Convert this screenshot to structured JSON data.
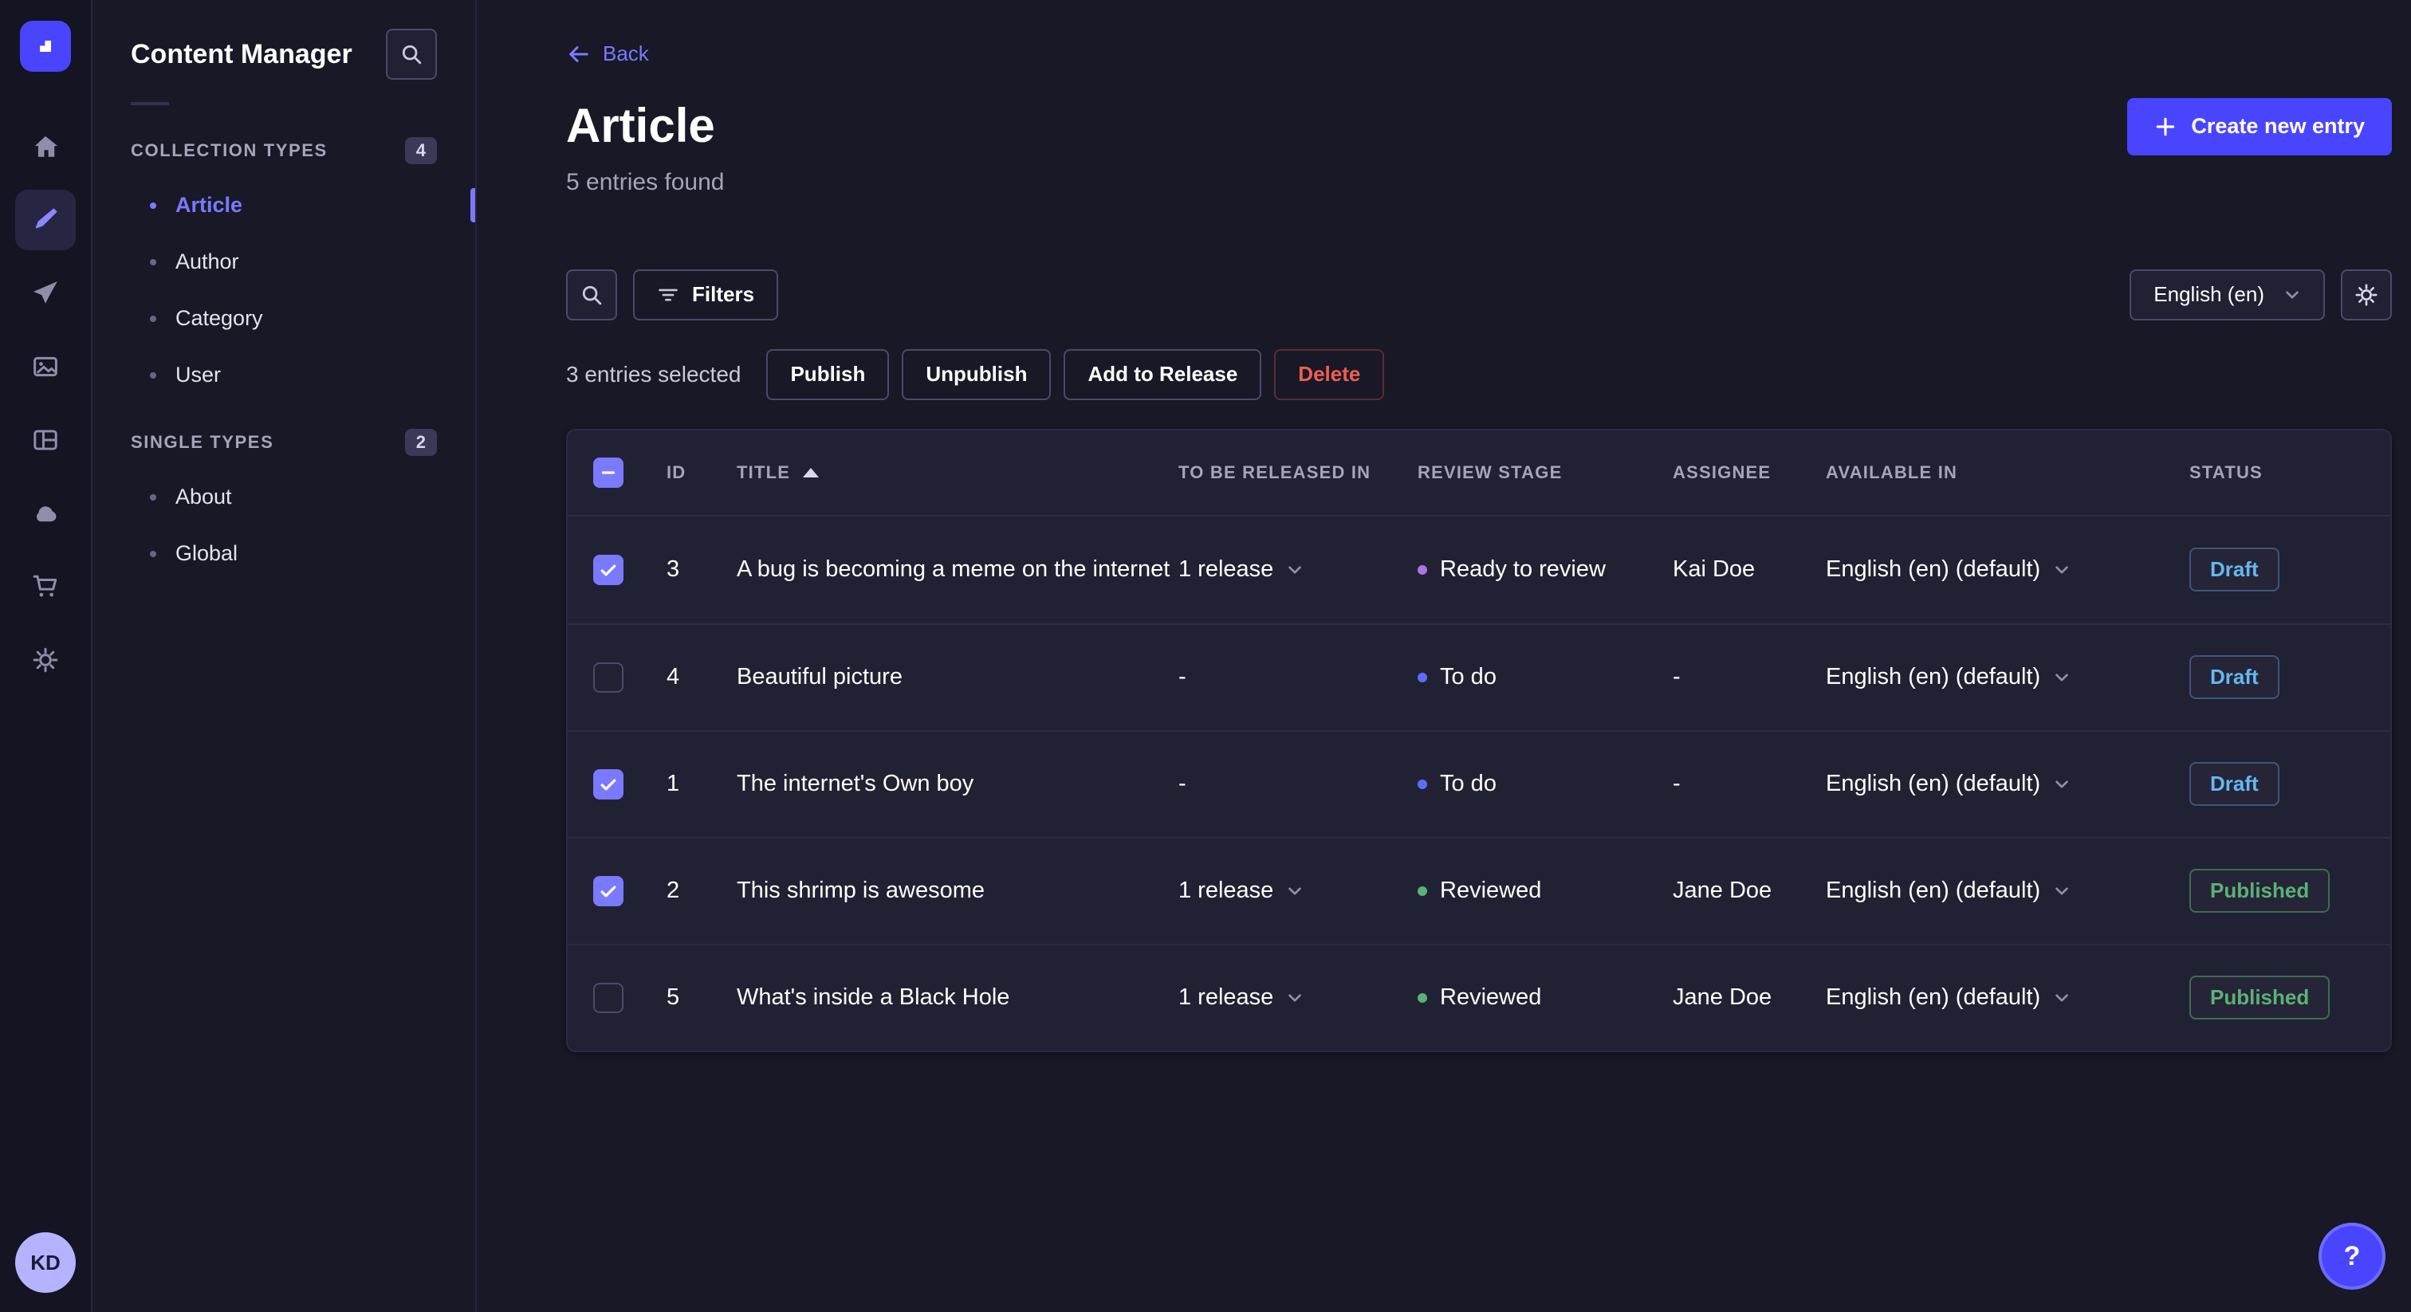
{
  "colors": {
    "accent": "#4945ff",
    "accent_light": "#7b79ff",
    "danger": "#ee5e52",
    "success": "#5cb176",
    "draft": "#66b7f1",
    "stage_ready_to_review": "#ac73e6",
    "stage_to_do": "#5a6eff",
    "stage_reviewed": "#5cb176"
  },
  "rail": {
    "logo_icon": "strapi-logo",
    "items": [
      {
        "icon": "home-icon",
        "active": false
      },
      {
        "icon": "content-manager-icon",
        "active": true
      },
      {
        "icon": "releases-icon",
        "active": false
      },
      {
        "icon": "media-library-icon",
        "active": false
      },
      {
        "icon": "content-type-builder-icon",
        "active": false
      },
      {
        "icon": "deploy-cloud-icon",
        "active": false
      },
      {
        "icon": "marketplace-icon",
        "active": false
      },
      {
        "icon": "settings-icon",
        "active": false
      }
    ],
    "avatar_initials": "KD"
  },
  "nav": {
    "title": "Content Manager",
    "sections": [
      {
        "label": "Collection Types",
        "badge": "4",
        "items": [
          {
            "label": "Article",
            "active": true
          },
          {
            "label": "Author",
            "active": false
          },
          {
            "label": "Category",
            "active": false
          },
          {
            "label": "User",
            "active": false
          }
        ]
      },
      {
        "label": "Single Types",
        "badge": "2",
        "items": [
          {
            "label": "About",
            "active": false
          },
          {
            "label": "Global",
            "active": false
          }
        ]
      }
    ]
  },
  "header": {
    "back": "Back",
    "title": "Article",
    "subtitle": "5 entries found",
    "create_button": "Create new entry"
  },
  "toolbar": {
    "filters_label": "Filters",
    "locale": "English (en)"
  },
  "selection": {
    "text": "3 entries selected",
    "actions": [
      {
        "label": "Publish",
        "danger": false
      },
      {
        "label": "Unpublish",
        "danger": false
      },
      {
        "label": "Add to Release",
        "danger": false
      },
      {
        "label": "Delete",
        "danger": true
      }
    ]
  },
  "table": {
    "headers": [
      "ID",
      "Title",
      "To be released in",
      "Review stage",
      "Assignee",
      "Available in",
      "Status"
    ],
    "sorted_by": "Title ascending",
    "rows": [
      {
        "checked": true,
        "id": "3",
        "title": "A bug is becoming a meme on the internet",
        "release": "1 release",
        "release_caret": true,
        "stage": "Ready to review",
        "stage_color": "#ac73e6",
        "assignee": "Kai Doe",
        "available": "English (en) (default)",
        "status": "Draft"
      },
      {
        "checked": false,
        "id": "4",
        "title": "Beautiful picture",
        "release": "-",
        "release_caret": false,
        "stage": "To do",
        "stage_color": "#5a6eff",
        "assignee": "-",
        "available": "English (en) (default)",
        "status": "Draft"
      },
      {
        "checked": true,
        "id": "1",
        "title": "The internet's Own boy",
        "release": "-",
        "release_caret": false,
        "stage": "To do",
        "stage_color": "#5a6eff",
        "assignee": "-",
        "available": "English (en) (default)",
        "status": "Draft"
      },
      {
        "checked": true,
        "id": "2",
        "title": "This shrimp is awesome",
        "release": "1 release",
        "release_caret": true,
        "stage": "Reviewed",
        "stage_color": "#5cb176",
        "assignee": "Jane Doe",
        "available": "English (en) (default)",
        "status": "Published"
      },
      {
        "checked": false,
        "id": "5",
        "title": "What's inside a Black Hole",
        "release": "1 release",
        "release_caret": true,
        "stage": "Reviewed",
        "stage_color": "#5cb176",
        "assignee": "Jane Doe",
        "available": "English (en) (default)",
        "status": "Published"
      }
    ]
  },
  "help": {
    "label": "?"
  }
}
